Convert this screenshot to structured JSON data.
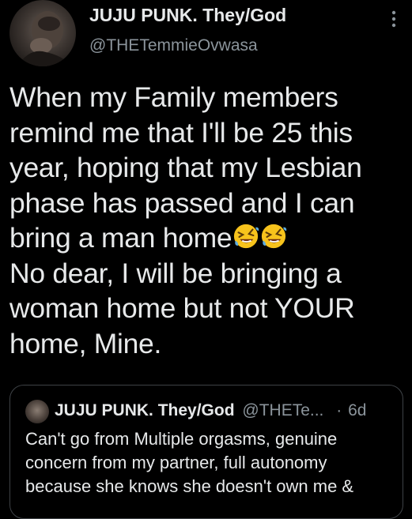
{
  "colors": {
    "background": "#000000",
    "text_primary": "#e7e9ea",
    "text_secondary": "#8b949b",
    "card_border": "#3e4246",
    "emoji_face": "#f7c31c"
  },
  "tweet": {
    "author": {
      "display_name": "JUJU PUNK. They/God",
      "handle": "@THETemmieOvwasa",
      "avatar_icon": "profile-photo"
    },
    "more_icon": "more-vertical-icon",
    "text_lines": [
      "When my Family members",
      "remind me that I'll be 25 this",
      "year, hoping that my Lesbian",
      "phase has passed and I can",
      "bring a man home",
      "No dear, I will be bringing a",
      "woman home but not YOUR",
      "home, Mine."
    ],
    "emojis": [
      "rolling-on-floor-laughing-emoji",
      "rolling-on-floor-laughing-emoji"
    ]
  },
  "quoted_tweet": {
    "display_name": "JUJU PUNK. They/God",
    "handle": "@THETe...",
    "separator": "·",
    "time": "6d",
    "text_lines": [
      "Can't go from Multiple orgasms, genuine",
      "concern from my partner, full autonomy",
      "because she knows she doesn't own me &"
    ]
  }
}
